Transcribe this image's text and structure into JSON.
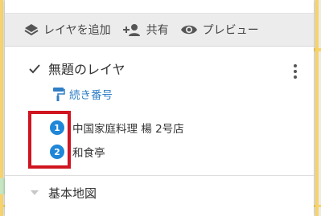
{
  "toolbar": {
    "add_layer": "レイヤを追加",
    "share": "共有",
    "preview": "プレビュー"
  },
  "layer": {
    "title": "無題のレイヤ",
    "style_label": "続き番号",
    "items": [
      {
        "number": "1",
        "name": "中国家庭料理 楊 2号店"
      },
      {
        "number": "2",
        "name": "和食亭"
      }
    ]
  },
  "basemap": {
    "label": "基本地図"
  },
  "colors": {
    "accent": "#2f7ec6",
    "marker": "#1f86d8",
    "highlight": "#d01420"
  }
}
